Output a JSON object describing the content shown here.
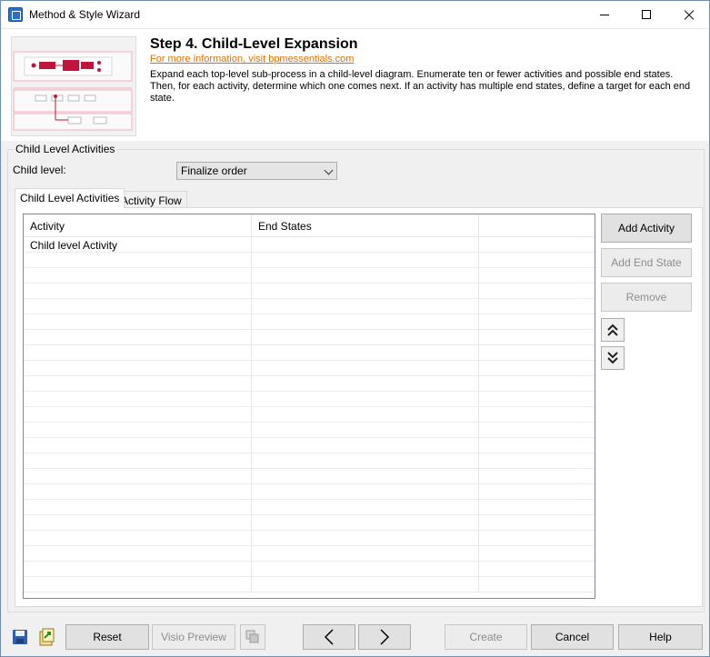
{
  "window": {
    "title": "Method & Style Wizard"
  },
  "header": {
    "step_title": "Step 4. Child-Level Expansion",
    "more_info_link": "For more information, visit bpmessentials.com",
    "description": "Expand each top-level sub-process in a child-level diagram. Enumerate ten or fewer activities and possible end states. Then, for each activity, determine which one comes next. If an activity has multiple end states, define a target for each end state."
  },
  "group": {
    "label": "Child Level Activities",
    "child_level_label": "Child level:",
    "child_level_selected": "Finalize order"
  },
  "tabs": [
    {
      "label": "Child Level Activities",
      "active": true
    },
    {
      "label": "Activity Flow",
      "active": false
    }
  ],
  "grid": {
    "columns": [
      "Activity",
      "End States",
      ""
    ],
    "rows": [
      [
        "Child level Activity",
        "",
        ""
      ]
    ]
  },
  "side_buttons": {
    "add_activity": "Add Activity",
    "add_end_state": "Add End State",
    "remove": "Remove"
  },
  "bottom_bar": {
    "reset": "Reset",
    "visio_preview": "Visio Preview",
    "create": "Create",
    "cancel": "Cancel",
    "help": "Help"
  },
  "colors": {
    "link": "#e07000",
    "accent_red": "#c0143c",
    "window_border": "#6d8fb4"
  }
}
